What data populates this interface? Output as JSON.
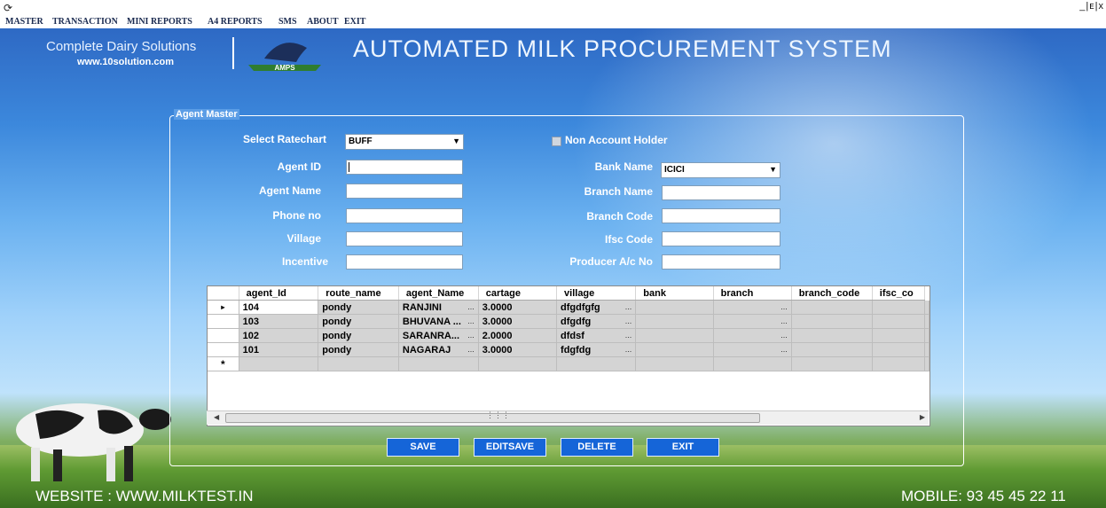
{
  "window": {
    "controls": "_|ᴇ|x"
  },
  "menu": [
    "MASTER",
    "TRANSACTION",
    "MINI REPORTS",
    "A4 REPORTS",
    "SMS",
    "ABOUT",
    "EXIT"
  ],
  "header": {
    "brand_line": "Complete Dairy Solutions",
    "brand_url": "www.10solution.com",
    "badge_text": "AMPS",
    "banner": "AUTOMATED MILK PROCUREMENT SYSTEM"
  },
  "form": {
    "group_title": "Agent Master",
    "ratechart_label": "Select Ratechart",
    "ratechart_value": "BUFF",
    "non_account_label": "Non Account Holder",
    "agent_id_label": "Agent ID",
    "agent_name_label": "Agent Name",
    "phone_label": "Phone no",
    "village_label": "Village",
    "incentive_label": "Incentive",
    "bank_name_label": "Bank Name",
    "bank_name_value": "ICICI",
    "branch_name_label": "Branch Name",
    "branch_code_label": "Branch Code",
    "ifsc_label": "Ifsc Code",
    "producer_ac_label": "Producer A/c No"
  },
  "grid": {
    "columns": [
      "agent_Id",
      "route_name",
      "agent_Name",
      "cartage",
      "village",
      "bank",
      "branch",
      "branch_code",
      "ifsc_co"
    ],
    "rows": [
      [
        "104",
        "pondy",
        "RANJINI",
        "3.0000",
        "dfgdfgfg",
        "",
        "",
        "",
        ""
      ],
      [
        "103",
        "pondy",
        "BHUVANA ...",
        "3.0000",
        "dfgdfg",
        "",
        "",
        "",
        ""
      ],
      [
        "102",
        "pondy",
        "SARANRA...",
        "2.0000",
        "dfdsf",
        "",
        "",
        "",
        ""
      ],
      [
        "101",
        "pondy",
        "NAGARAJ",
        "3.0000",
        "fdgfdg",
        "",
        "",
        "",
        ""
      ]
    ],
    "current_marker": "▸",
    "new_row_marker": "*"
  },
  "buttons": {
    "save": "SAVE",
    "editsave": "EDITSAVE",
    "delete": "DELETE",
    "exit": "EXIT"
  },
  "footer": {
    "website": "WEBSITE : WWW.MILKTEST.IN",
    "mobile": "MOBILE: 93 45 45 22 11"
  },
  "colors": {
    "sky_top": "#2e69c4",
    "button": "#1565d8",
    "grid_row": "#d4d4d4"
  }
}
